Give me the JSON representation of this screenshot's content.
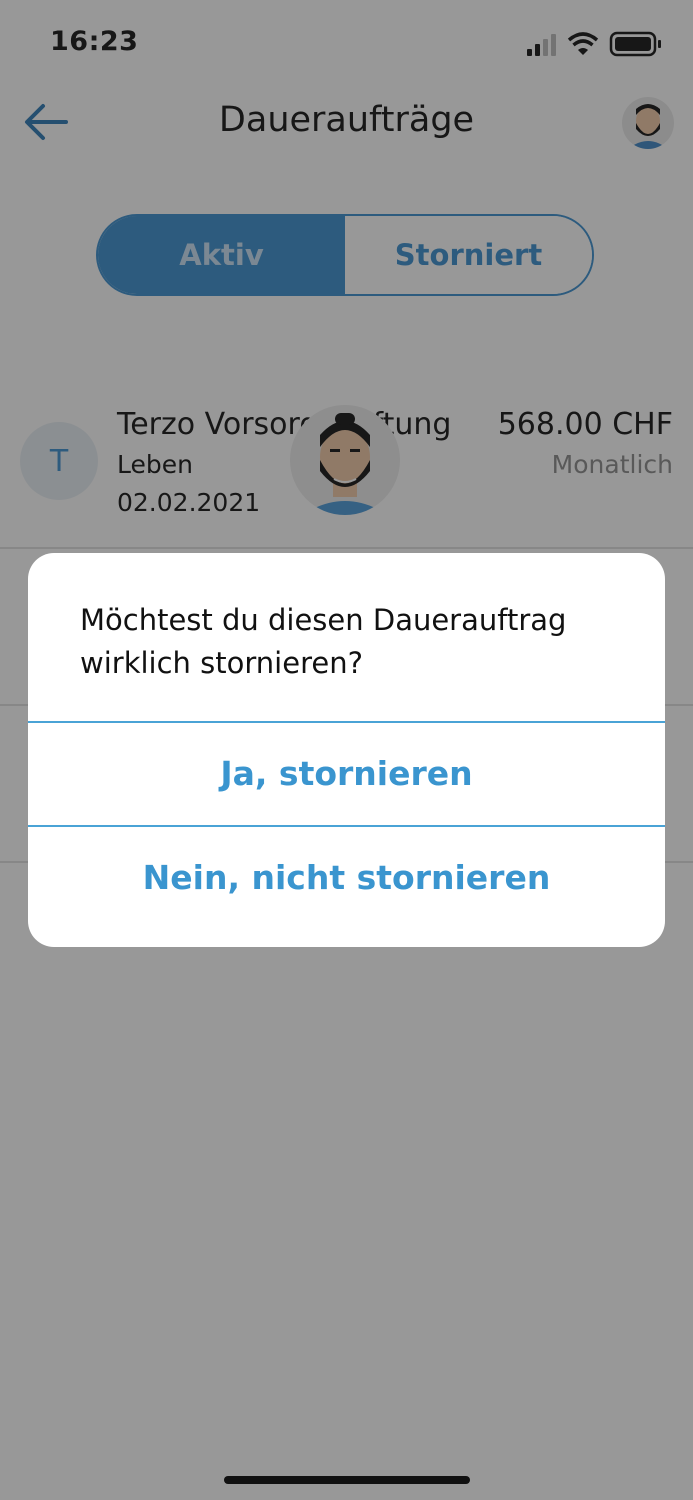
{
  "status_bar": {
    "time": "16:23"
  },
  "header": {
    "title": "Daueraufträge"
  },
  "tabs": [
    {
      "label": "Aktiv",
      "active": true
    },
    {
      "label": "Storniert",
      "active": false
    }
  ],
  "orders": [
    {
      "initial": "T",
      "name": "Terzo Vorsorgestiftung",
      "category": "Leben",
      "date": "02.02.2021",
      "amount": "568.00 CHF",
      "frequency": "Monatlich"
    }
  ],
  "dialog": {
    "message": "Möchtest du diesen Dauerauftrag wirklich stornieren?",
    "confirm_label": "Ja, stornieren",
    "cancel_label": "Nein, nicht stornieren"
  },
  "colors": {
    "accent": "#3a8fd0",
    "dialog_button": "#3a95cf",
    "scrim": "#979797"
  }
}
